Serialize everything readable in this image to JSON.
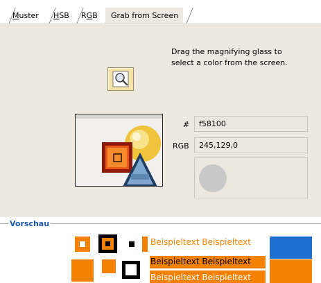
{
  "tabs": [
    {
      "label": "Muster",
      "underline_char": "M",
      "rest": "uster"
    },
    {
      "label": "HSB",
      "underline_char": "H",
      "rest": "SB"
    },
    {
      "label": "RGB",
      "underline_char": "G",
      "pre": "R",
      "rest": "B"
    },
    {
      "label": "Grab from Screen"
    }
  ],
  "grab": {
    "instruction_line1": "Drag the magnifying glass to",
    "instruction_line2": "select a color from the screen.",
    "magnifier_icon": "magnifying-glass-icon"
  },
  "fields": {
    "hex_label": "#",
    "hex_value": "f58100",
    "rgb_label": "RGB",
    "rgb_value": "245,129,0",
    "swatch_color": "#c8c8c8"
  },
  "vorschau": {
    "title": "Vorschau",
    "sample_text": "Beispieltext Beispieltext",
    "row1_text": "Beispieltext Beispieltext",
    "row2_text": "Beispieltext Beispieltext",
    "row3_text": "Beispieltext Beispieltext"
  },
  "colors": {
    "selected": "#f58100",
    "blue": "#1e6fd0",
    "panel_bg": "#ede9e1",
    "section_title": "#1c57a5"
  }
}
